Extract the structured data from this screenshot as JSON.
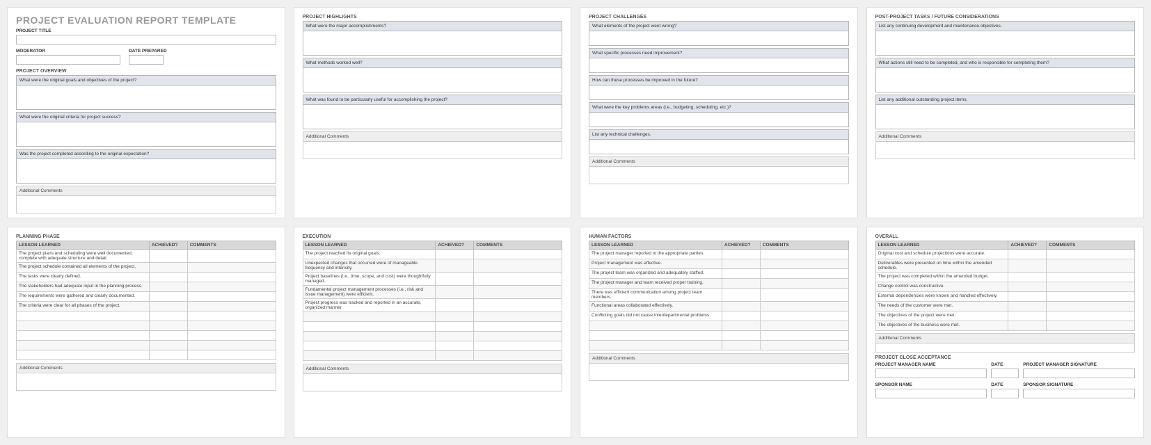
{
  "p1": {
    "main_title": "PROJECT EVALUATION REPORT TEMPLATE",
    "project_title_label": "PROJECT TITLE",
    "moderator_label": "MODERATOR",
    "date_prepared_label": "DATE PREPARED",
    "overview_title": "PROJECT OVERVIEW",
    "q1": "What were the original goals and objectives of the project?",
    "q2": "What were the original criteria for project success?",
    "q3": "Was the project completed according to the original expectation?",
    "additional_comments": "Additional Comments"
  },
  "p2": {
    "title": "PROJECT HIGHLIGHTS",
    "q1": "What were the major accomplishments?",
    "q2": "What methods worked well?",
    "q3": "What was found to be particularly useful for accomplishing the project?",
    "additional_comments": "Additional Comments"
  },
  "p3": {
    "title": "PROJECT CHALLENGES",
    "q1": "What elements of the project went wrong?",
    "q2": "What specific processes need improvement?",
    "q3": "How can these processes be improved in the future?",
    "q4": "What were the key problems areas (i.e., budgeting, scheduling, etc.)?",
    "q5": "List any technical challenges.",
    "additional_comments": "Additional Comments"
  },
  "p4": {
    "title": "POST-PROJECT TASKS / FUTURE CONSIDERATIONS",
    "q1": "List any continuing development and maintenance objectives.",
    "q2": "What actions still need to be completed, and who is responsible for completing them?",
    "q3": "List any additional outstanding project items.",
    "additional_comments": "Additional Comments"
  },
  "table_headers": {
    "lesson": "LESSON LEARNED",
    "achieved": "ACHIEVED?",
    "comments": "COMMENTS"
  },
  "p5": {
    "title": "PLANNING PHASE",
    "rows": [
      "The project plans and scheduling were well documented, complete with adequate structure and detail.",
      "The project schedule contained all elements of the project.",
      "The tasks were clearly defined.",
      "The stakeholders had adequate input in the planning process.",
      "The requirements were gathered and clearly documented.",
      "The criteria were clear for all phases of the project.",
      "",
      "",
      "",
      "",
      ""
    ],
    "additional_comments": "Additional Comments"
  },
  "p6": {
    "title": "EXECUTION",
    "rows": [
      "The project reached its original goals.",
      "Unexpected changes that occurred were of manageable frequency and intensity.",
      "Project baselines (i.e., time, scope, and cost) were thoughtfully managed.",
      "Fundamental project management processes (i.e., risk and issue management) were efficient.",
      "Project progress was tracked and reported in an accurate, organized manner.",
      "",
      "",
      "",
      "",
      ""
    ],
    "additional_comments": "Additional Comments"
  },
  "p7": {
    "title": "HUMAN FACTORS",
    "rows": [
      "The project manager reported to the appropriate parties.",
      "Project management was effective.",
      "The project team was organized and adequately staffed.",
      "The project manager and team received proper training.",
      "There was efficient communication among project team members.",
      "Functional areas collaborated effectively.",
      "Conflicting goals did not cause interdepartmental problems.",
      "",
      "",
      ""
    ],
    "additional_comments": "Additional Comments"
  },
  "p8": {
    "title": "OVERALL",
    "rows": [
      "Original cost and schedule projections were accurate.",
      "Deliverables were presented on time within the amended schedule.",
      "The project was completed within the amended budget.",
      "Change control was constructive.",
      "External dependencies were known and handled effectively.",
      "The needs of the customer were met.",
      "The objectives of the project were met.",
      "The objectives of the business were met."
    ],
    "additional_comments": "Additional Comments",
    "close_title": "PROJECT CLOSE ACCEPTANCE",
    "pm_name": "PROJECT MANAGER NAME",
    "date": "DATE",
    "pm_sig": "PROJECT MANAGER SIGNATURE",
    "sponsor_name": "SPONSOR NAME",
    "sponsor_sig": "SPONSOR SIGNATURE"
  }
}
